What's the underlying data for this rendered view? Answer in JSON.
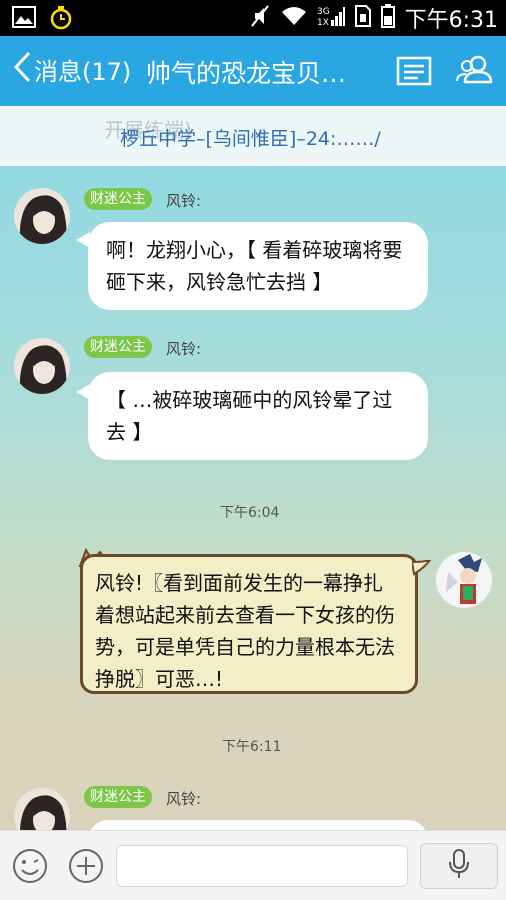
{
  "status_bar": {
    "time": "下午6:31"
  },
  "header": {
    "back_label": "消息(17)",
    "title": "帅气的恐龙宝贝…"
  },
  "top_message": {
    "ghost_text": "开展练端)",
    "text": "椤丘中学–[乌间惟臣]–24:……/"
  },
  "messages": [
    {
      "badge": "财迷公主",
      "sender": "风铃:",
      "text": "啊！龙翔小心，【 看着碎玻璃将要砸下来，风铃急忙去挡 】"
    },
    {
      "badge": "财迷公主",
      "sender": "风铃:",
      "text": "【 …被碎玻璃砸中的风铃晕了过去 】"
    },
    {
      "badge": "财迷公主",
      "sender": "风铃:",
      "text": ""
    }
  ],
  "timestamps": [
    "下午6:04",
    "下午6:11"
  ],
  "my_message": {
    "text": "风铃!〖看到面前发生的一幕挣扎着想站起来前去查看一下女孩的伤势，可是单凭自己的力量根本无法挣脱〗可恶…!"
  },
  "colors": {
    "header": "#2aa7e3",
    "badge": "#7dc64a",
    "link": "#2d6fb5"
  },
  "icons": [
    "gallery-icon",
    "clock-icon",
    "mute-icon",
    "wifi-icon",
    "signal-icon",
    "battery-icon",
    "chevron-left-icon",
    "profile-card-icon",
    "group-icon",
    "emoji-icon",
    "plus-icon",
    "microphone-icon"
  ]
}
